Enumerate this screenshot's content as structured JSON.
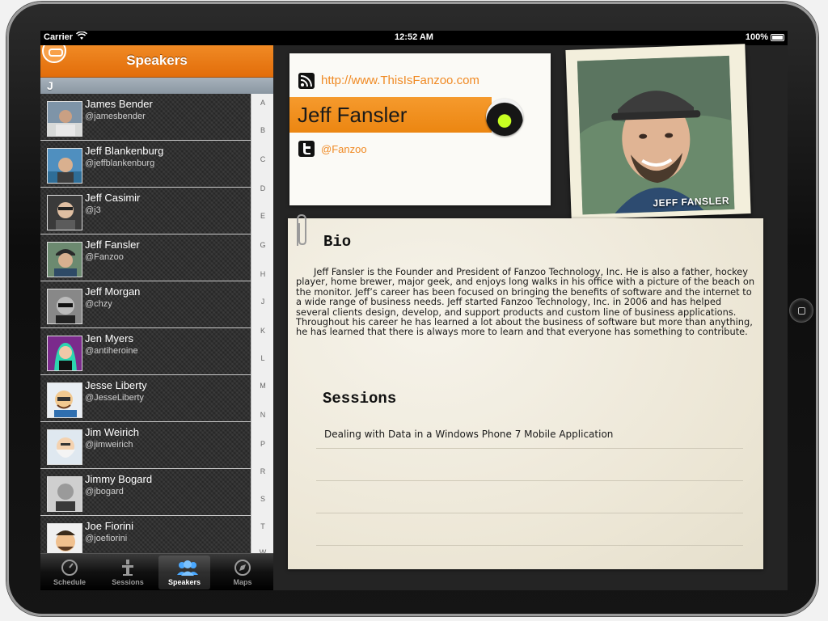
{
  "status_bar": {
    "carrier": "Carrier",
    "time": "12:52 AM",
    "battery": "100%"
  },
  "left_panel": {
    "title": "Speakers",
    "section_letter": "J",
    "speakers": [
      {
        "name": "James Bender",
        "handle": "@jamesbender"
      },
      {
        "name": "Jeff Blankenburg",
        "handle": "@jeffblankenburg"
      },
      {
        "name": "Jeff Casimir",
        "handle": "@j3"
      },
      {
        "name": "Jeff Fansler",
        "handle": "@Fanzoo"
      },
      {
        "name": "Jeff Morgan",
        "handle": "@chzy"
      },
      {
        "name": "Jen Myers",
        "handle": "@antiheroine"
      },
      {
        "name": "Jesse Liberty",
        "handle": "@JesseLiberty"
      },
      {
        "name": "Jim Weirich",
        "handle": "@jimweirich"
      },
      {
        "name": "Jimmy Bogard",
        "handle": "@jbogard"
      },
      {
        "name": "Joe Fiorini",
        "handle": "@joefiorini"
      }
    ],
    "index_letters": [
      "A",
      "B",
      "C",
      "D",
      "E",
      "G",
      "H",
      "J",
      "K",
      "L",
      "M",
      "N",
      "P",
      "R",
      "S",
      "T",
      "W"
    ]
  },
  "tabs": [
    {
      "label": "Schedule",
      "icon": "clock-icon"
    },
    {
      "label": "Sessions",
      "icon": "podium-icon"
    },
    {
      "label": "Speakers",
      "icon": "people-icon"
    },
    {
      "label": "Maps",
      "icon": "compass-icon"
    }
  ],
  "detail": {
    "website": "http://www.ThisIsFanzoo.com",
    "name": "Jeff Fansler",
    "twitter": "@Fanzoo",
    "photo_caption": "JEFF FANSLER",
    "bio_heading": "Bio",
    "bio": "Jeff Fansler is the Founder and President of Fanzoo Technology, Inc. He is also a father, hockey player, home brewer, major geek, and enjoys long walks in his office with a picture of the beach on the monitor. Jeff’s career has been focused on bringing the benefits of software and the internet to a wide range of business needs. Jeff started Fanzoo Technology, Inc. in 2006 and has helped several clients design, develop, and support products and custom line of business applications. Throughout his career he has learned a lot about the business of software but more than anything, he has learned that there is always more to learn and that everyone has something to contribute.",
    "sessions_heading": "Sessions",
    "sessions": [
      "Dealing with Data in a Windows Phone 7 Mobile Application"
    ]
  },
  "colors": {
    "accent": "#f08a24",
    "index_bg": "#efefef",
    "paper": "#f1ede2"
  }
}
